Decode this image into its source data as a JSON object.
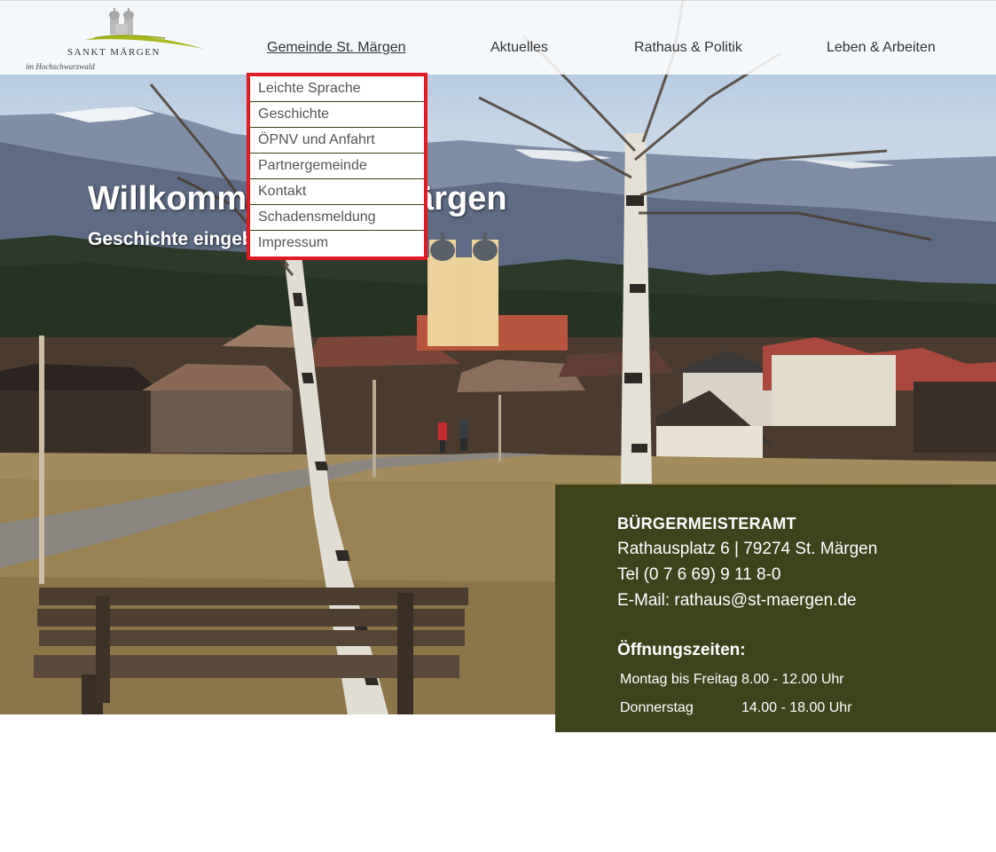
{
  "header": {
    "logo": {
      "name": "SANKT MÄRGEN",
      "tagline": "im Hochschwarzwald"
    },
    "nav": [
      {
        "label": "Gemeinde St. Märgen",
        "active": true
      },
      {
        "label": "Aktuelles",
        "active": false
      },
      {
        "label": "Rathaus & Politik",
        "active": false
      },
      {
        "label": "Leben & Arbeiten",
        "active": false
      }
    ]
  },
  "dropdown": {
    "items": [
      {
        "label": "Leichte Sprache"
      },
      {
        "label": "Geschichte"
      },
      {
        "label": "ÖPNV und Anfahrt"
      },
      {
        "label": "Partnergemeinde"
      },
      {
        "label": "Kontakt"
      },
      {
        "label": "Schadensmeldung"
      },
      {
        "label": "Impressum"
      }
    ],
    "highlight_color": "#e01a22"
  },
  "hero": {
    "title": "Willkommen in St. Märgen",
    "subtitle": "Geschichte eingebettet in Natur"
  },
  "contact": {
    "heading": "BÜRGERMEISTERAMT",
    "address": "Rathausplatz 6 | 79274 St. Märgen",
    "phone": "Tel (0 7 6 69) 9 11 8-0",
    "email_label": "E-Mail: ",
    "email": "rathaus@st-maergen.de",
    "hours_heading": "Öffnungszeiten:",
    "hours": [
      {
        "day": "Montag bis Freitag",
        "time": "8.00 - 12.00 Uhr"
      },
      {
        "day": "Donnerstag",
        "time": "14.00 - 18.00 Uhr"
      }
    ],
    "background_color": "#3f431b"
  }
}
